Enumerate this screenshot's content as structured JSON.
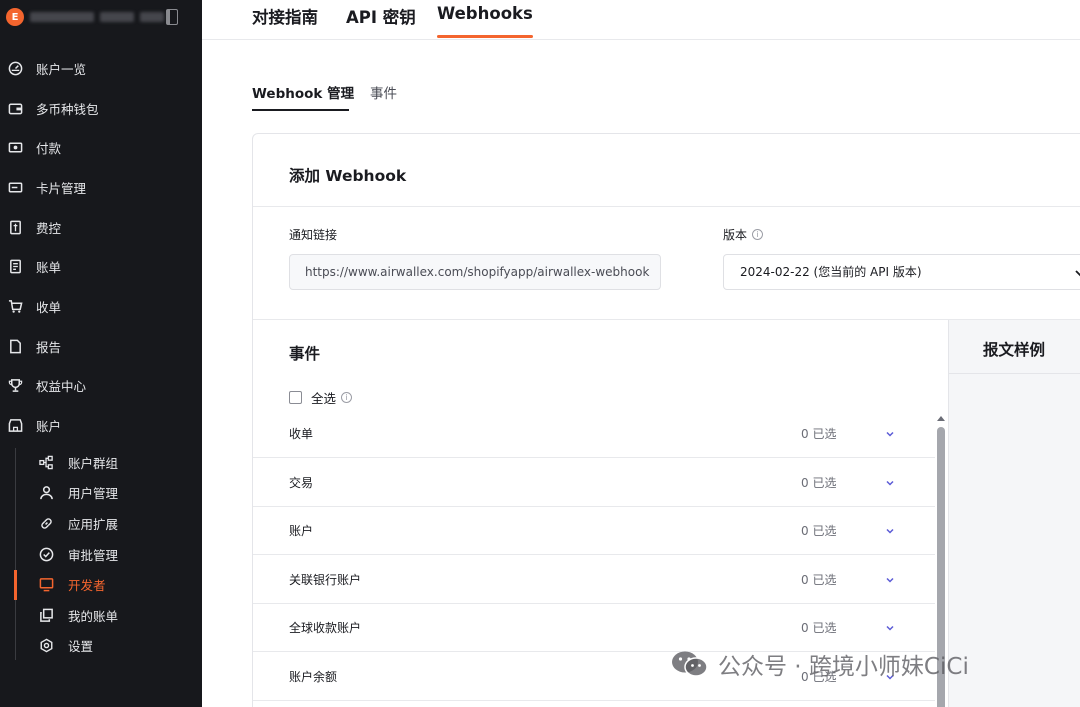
{
  "sidebar": {
    "logo_letter": "E",
    "items": [
      {
        "label": "账户一览",
        "icon": "dashboard-icon"
      },
      {
        "label": "多币种钱包",
        "icon": "wallet-icon"
      },
      {
        "label": "付款",
        "icon": "payment-icon"
      },
      {
        "label": "卡片管理",
        "icon": "card-icon"
      },
      {
        "label": "费控",
        "icon": "expense-icon"
      },
      {
        "label": "账单",
        "icon": "bill-icon"
      },
      {
        "label": "收单",
        "icon": "cart-icon"
      },
      {
        "label": "报告",
        "icon": "report-icon"
      },
      {
        "label": "权益中心",
        "icon": "trophy-icon"
      },
      {
        "label": "账户",
        "icon": "account-icon"
      }
    ],
    "sub_items": [
      {
        "label": "账户群组",
        "icon": "group-icon"
      },
      {
        "label": "用户管理",
        "icon": "user-icon"
      },
      {
        "label": "应用扩展",
        "icon": "link-icon"
      },
      {
        "label": "审批管理",
        "icon": "check-circle-icon"
      },
      {
        "label": "开发者",
        "icon": "monitor-icon",
        "active": true
      },
      {
        "label": "我的账单",
        "icon": "copy-icon"
      },
      {
        "label": "设置",
        "icon": "gear-icon"
      }
    ]
  },
  "top_tabs": [
    {
      "label": "对接指南"
    },
    {
      "label": "API 密钥"
    },
    {
      "label": "Webhooks",
      "active": true
    }
  ],
  "sub_tabs": [
    {
      "label": "Webhook 管理",
      "active": true
    },
    {
      "label": "事件"
    }
  ],
  "form": {
    "title": "添加 Webhook",
    "url_label": "通知链接",
    "url_value": "https://www.airwallex.com/shopifyapp/airwallex-webhook",
    "version_label": "版本",
    "version_value": "2024-02-22 (您当前的 API 版本)"
  },
  "events": {
    "title": "事件",
    "select_all": "全选",
    "rows": [
      {
        "name": "收单",
        "count": "0 已选"
      },
      {
        "name": "交易",
        "count": "0 已选"
      },
      {
        "name": "账户",
        "count": "0 已选"
      },
      {
        "name": "关联银行账户",
        "count": "0 已选"
      },
      {
        "name": "全球收款账户",
        "count": "0 已选"
      },
      {
        "name": "账户余额",
        "count": "0 已选"
      }
    ]
  },
  "sample": {
    "title": "报文样例"
  },
  "watermark": {
    "text": "公众号 · 跨境小师妹CiCi"
  },
  "colors": {
    "accent": "#f4652e",
    "sidebar_bg": "#17181c",
    "chevron": "#5b5bd6"
  }
}
